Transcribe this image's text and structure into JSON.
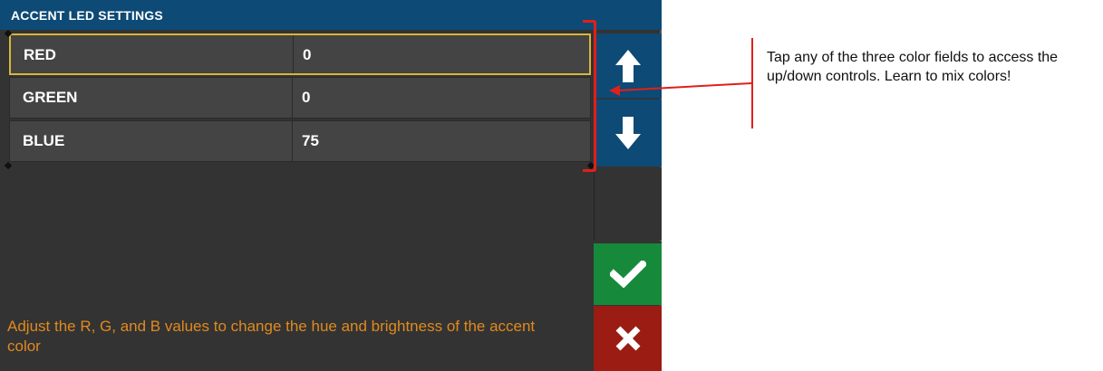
{
  "title": "ACCENT LED SETTINGS",
  "fields": [
    {
      "label": "RED",
      "value": "0",
      "selected": true
    },
    {
      "label": "GREEN",
      "value": "0",
      "selected": false
    },
    {
      "label": "BLUE",
      "value": "75",
      "selected": false
    }
  ],
  "side_buttons": {
    "up_icon": "arrow-up-icon",
    "down_icon": "arrow-down-icon",
    "ok_icon": "check-icon",
    "cancel_icon": "close-icon"
  },
  "hint": "Adjust the R, G, and B values to change the hue and brightness of the accent color",
  "callout": "Tap any of the three color fields to access the up/down controls. Learn to mix colors!",
  "colors": {
    "title_bar": "#0d4a75",
    "panel_bg": "#333333",
    "row_bg": "#444444",
    "selected_border": "#d9b53c",
    "ok": "#168a3a",
    "cancel": "#9a1c12",
    "hint_text": "#e08a1e",
    "annotation": "#e0201a"
  }
}
